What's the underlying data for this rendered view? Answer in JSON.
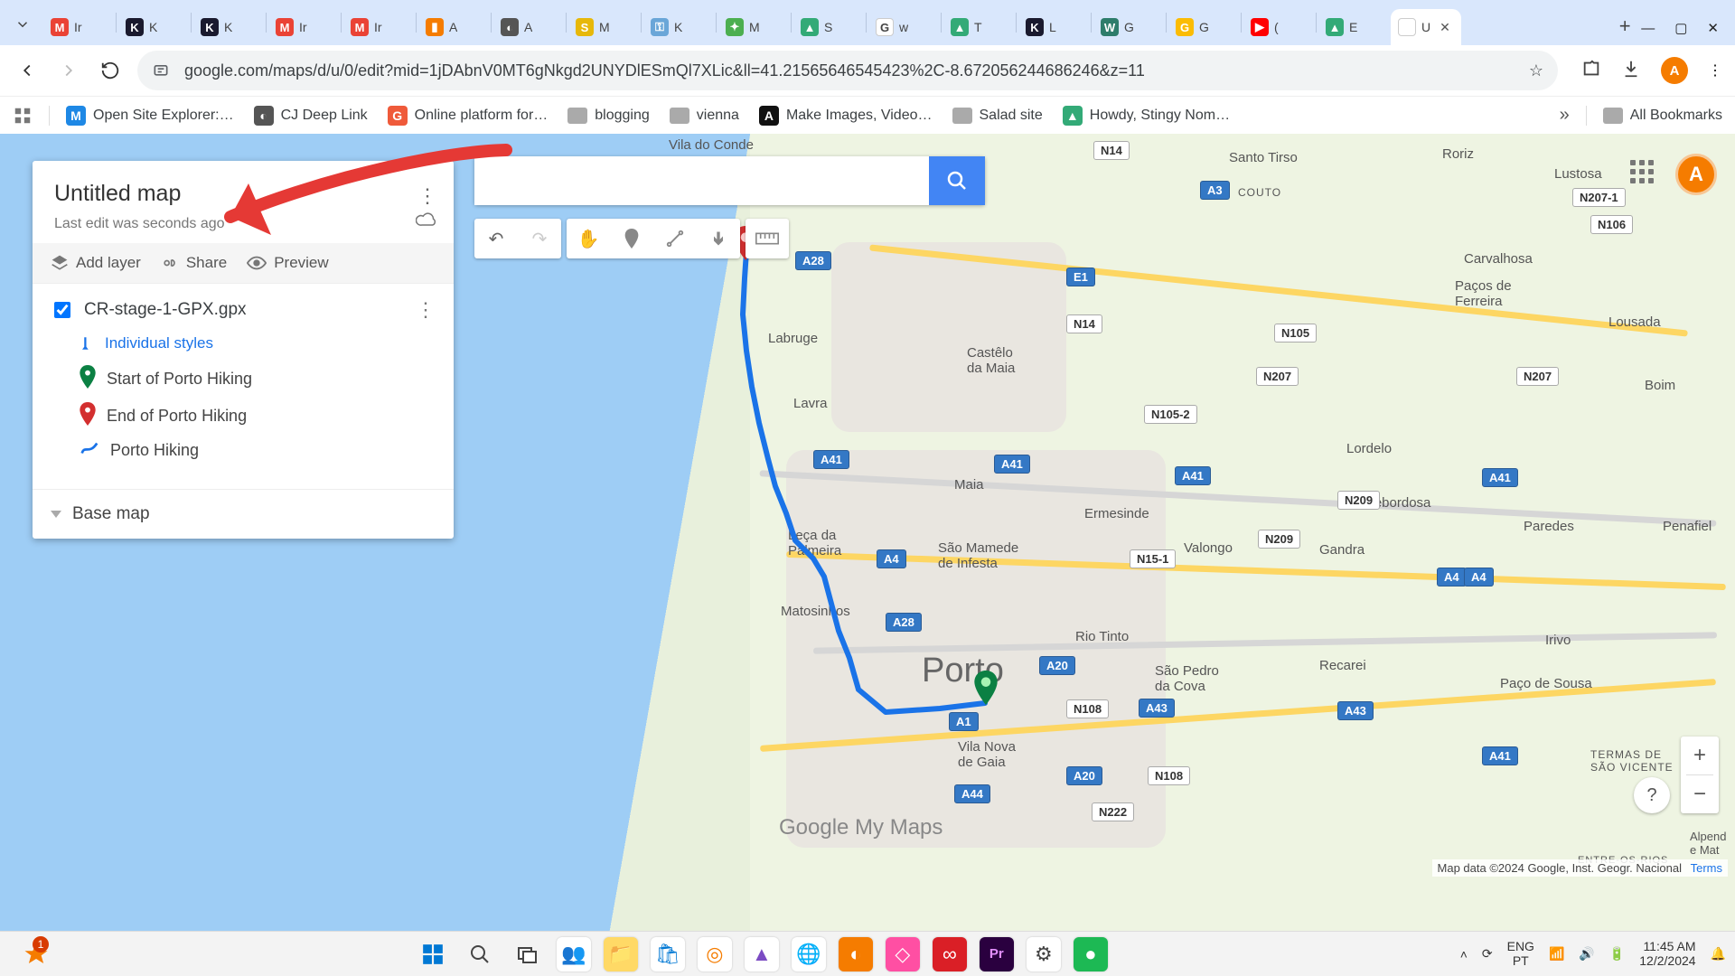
{
  "browser": {
    "tabs": [
      {
        "favicon": "M",
        "favcolor": "#ea4335",
        "label": "Ir"
      },
      {
        "favicon": "K",
        "favcolor": "#1a1a2e",
        "label": "K"
      },
      {
        "favicon": "K",
        "favcolor": "#1a1a2e",
        "label": "K"
      },
      {
        "favicon": "M",
        "favcolor": "#ea4335",
        "label": "Ir"
      },
      {
        "favicon": "M",
        "favcolor": "#ea4335",
        "label": "Ir"
      },
      {
        "favicon": "▮",
        "favcolor": "#f57c00",
        "label": "A"
      },
      {
        "favicon": "◐",
        "favcolor": "#555",
        "label": "A"
      },
      {
        "favicon": "S",
        "favcolor": "#e7b80a",
        "label": "M"
      },
      {
        "favicon": "⚿",
        "favcolor": "#6aa6d8",
        "label": "K"
      },
      {
        "favicon": "✦",
        "favcolor": "#4caf50",
        "label": "M"
      },
      {
        "favicon": "▲",
        "favcolor": "#3a7",
        "label": "S"
      },
      {
        "favicon": "G",
        "favcolor": "#fff",
        "label": "w"
      },
      {
        "favicon": "▲",
        "favcolor": "#3a7",
        "label": "T"
      },
      {
        "favicon": "K",
        "favcolor": "#1a1a2e",
        "label": "L"
      },
      {
        "favicon": "W",
        "favcolor": "#2e7d6b",
        "label": "G"
      },
      {
        "favicon": "G",
        "favcolor": "#fbbc04",
        "label": "G"
      },
      {
        "favicon": "▶",
        "favcolor": "#ff0000",
        "label": "("
      },
      {
        "favicon": "▲",
        "favcolor": "#3a7",
        "label": "E"
      },
      {
        "favicon": "",
        "favcolor": "#fff",
        "label": "U",
        "active": true
      }
    ],
    "url": "google.com/maps/d/u/0/edit?mid=1jDAbnV0MT6gNkgd2UNYDlESmQl7XLic&ll=41.21565646545423%2C-8.672056244686246&z=11",
    "avatar_initial": "A"
  },
  "bookmarks": [
    {
      "icon": "grid",
      "label": ""
    },
    {
      "icon": "M",
      "color": "#1e88e5",
      "label": "Open Site Explorer:…"
    },
    {
      "icon": "◐",
      "color": "#555",
      "label": "CJ Deep Link"
    },
    {
      "icon": "G",
      "color": "#ef5a3a",
      "label": "Online platform for…"
    },
    {
      "icon": "folder",
      "label": "blogging"
    },
    {
      "icon": "folder",
      "label": "vienna"
    },
    {
      "icon": "A",
      "color": "#111",
      "label": "Make Images, Video…"
    },
    {
      "icon": "folder",
      "label": "Salad site"
    },
    {
      "icon": "▲",
      "color": "#3a7",
      "label": "Howdy, Stingy Nom…"
    }
  ],
  "bookmarks_overflow": "»",
  "all_bookmarks": "All Bookmarks",
  "panel": {
    "title": "Untitled map",
    "subtitle": "Last edit was seconds ago",
    "actions": {
      "add_layer": "Add layer",
      "share": "Share",
      "preview": "Preview"
    },
    "layer_name": "CR-stage-1-GPX.gpx",
    "styles_label": "Individual styles",
    "items": [
      {
        "label": "Start of Porto Hiking",
        "marker": "green"
      },
      {
        "label": "End of Porto Hiking",
        "marker": "red"
      },
      {
        "label": "Porto Hiking",
        "marker": "line"
      }
    ],
    "basemap": "Base map"
  },
  "map": {
    "search_placeholder": "",
    "labels": {
      "porto": "Porto",
      "vilanova": "Vila Nova\nde Gaia",
      "viladoconde": "Vila do Conde",
      "maia": "Maia",
      "matosinhos": "Matosinhos",
      "leca": "Leça da\nPalmeira",
      "ermesinde": "Ermesinde",
      "rio_tinto": "Rio Tinto",
      "valongo": "Valongo",
      "gondomar": "Gandra",
      "sao_mamede": "São Mamede\nde Infesta",
      "lavra": "Lavra",
      "labruge": "Labruge",
      "castelo": "Castêlo\nda Maia",
      "santo_tirso": "Santo Tirso",
      "roriz": "Roriz",
      "lustosa": "Lustosa",
      "carvalhosa": "Carvalhosa",
      "pacos": "Paços de\nFerreira",
      "lousada": "Lousada",
      "boim": "Boim",
      "lordelo": "Lordelo",
      "rebordosa": "Rebordosa",
      "paredes": "Paredes",
      "penafiel": "Penafiel",
      "sao_pedro": "São Pedro\nda Cova",
      "recarei": "Recarei",
      "irivo": "Irivo",
      "paco_sousa": "Paço de Sousa",
      "termas": "TERMAS DE\nSÃO VICENTE",
      "alpend": "Alpend\ne Mat",
      "entre": "ENTRE-OS-RIOS",
      "couto": "COUTO"
    },
    "shields": [
      "N14",
      "A3",
      "N207-1",
      "N106",
      "A28",
      "E1",
      "N14",
      "N105",
      "N105-2",
      "N207",
      "N207",
      "A41",
      "A41",
      "A41",
      "A41",
      "N209",
      "A4",
      "N15-1",
      "N209",
      "A28",
      "A4",
      "A4",
      "A20",
      "N108",
      "A43",
      "A43",
      "A1",
      "A20",
      "N108",
      "A44",
      "N222",
      "A41"
    ],
    "logo": "Google My Maps",
    "attribution": "Map data ©2024 Google, Inst. Geogr. Nacional",
    "terms": "Terms"
  },
  "taskbar": {
    "badge": "1",
    "lang_top": "ENG",
    "lang_bot": "PT",
    "time": "11:45 AM",
    "date": "12/2/2024"
  }
}
